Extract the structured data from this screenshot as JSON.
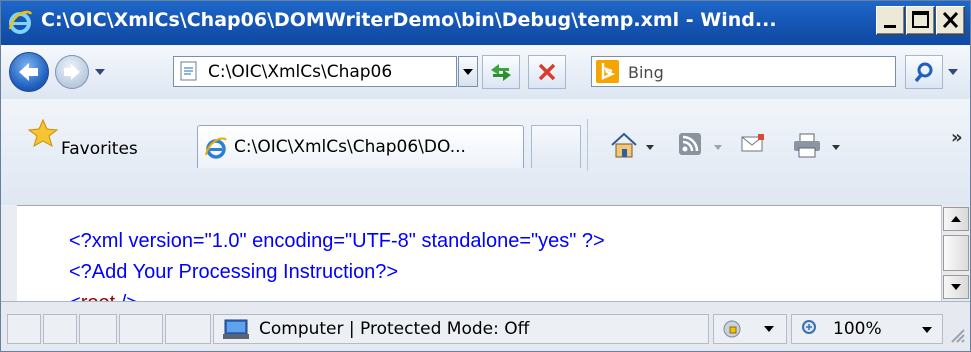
{
  "window": {
    "title": "C:\\OIC\\XmlCs\\Chap06\\DOMWriterDemo\\bin\\Debug\\temp.xml - Wind..."
  },
  "address_bar": {
    "url": "C:\\OIC\\XmlCs\\Chap06"
  },
  "search": {
    "placeholder": "Bing"
  },
  "favorites": {
    "label": "Favorites"
  },
  "tab": {
    "title": "C:\\OIC\\XmlCs\\Chap06\\DO..."
  },
  "document": {
    "line1": "<?xml version=\"1.0\" encoding=\"UTF-8\" standalone=\"yes\" ?>",
    "line2": "<?Add Your Processing Instruction?>",
    "line3_open": "<",
    "line3_tag": "root",
    "line3_close": " />"
  },
  "status_bar": {
    "zone_text": "Computer | Protected Mode: Off",
    "zoom": "100%"
  },
  "colors": {
    "title_bar": "#1554b2",
    "xml_markup": "#0000ff",
    "xml_tag_name": "#990000"
  },
  "icons": {
    "title": "ie-logo-icon",
    "back": "back-arrow-icon",
    "forward": "forward-arrow-icon",
    "refresh": "refresh-icon",
    "stop": "stop-icon",
    "search_provider": "bing-icon",
    "search": "magnifier-icon",
    "favorites": "star-icon",
    "home": "home-icon",
    "feeds": "rss-icon",
    "mail": "mail-icon",
    "print": "printer-icon",
    "zone": "computer-icon",
    "protected": "shield-lock-icon",
    "zoom": "zoom-icon"
  }
}
